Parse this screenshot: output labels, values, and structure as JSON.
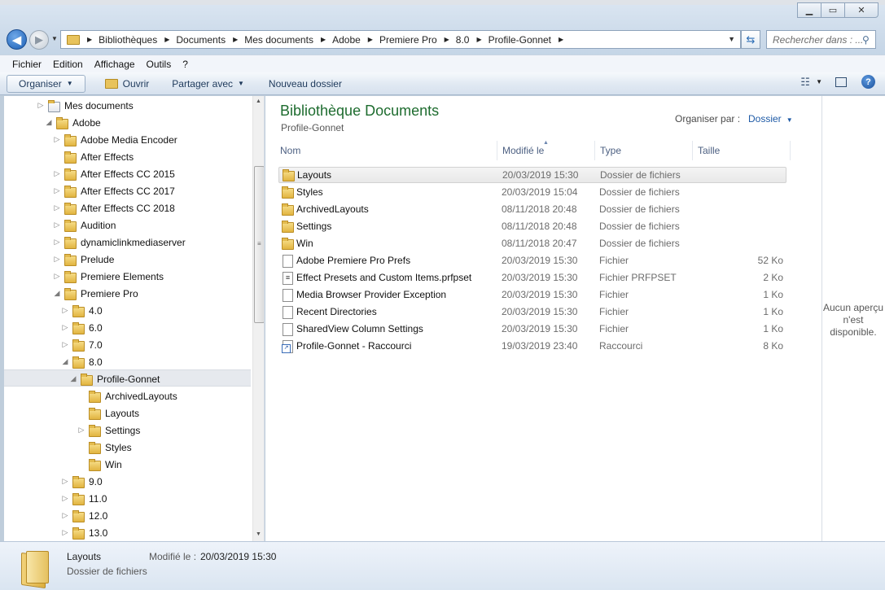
{
  "window": {
    "buttons": {
      "minimize": "▁",
      "maximize": "▭",
      "close": "✕"
    }
  },
  "address": {
    "crumbs": [
      "Bibliothèques",
      "Documents",
      "Mes documents",
      "Adobe",
      "Premiere Pro",
      "8.0",
      "Profile-Gonnet"
    ],
    "search_placeholder": "Rechercher dans : ..."
  },
  "menu": [
    "Fichier",
    "Edition",
    "Affichage",
    "Outils",
    "?"
  ],
  "toolbar": {
    "organiser": "Organiser",
    "ouvrir": "Ouvrir",
    "partager": "Partager avec",
    "nouveau": "Nouveau dossier"
  },
  "tree": [
    {
      "label": "Mes documents",
      "indent": 0,
      "expander": "▷",
      "icon": "doc"
    },
    {
      "label": "Adobe",
      "indent": 1,
      "expander": "◢",
      "icon": "folder"
    },
    {
      "label": "Adobe Media Encoder",
      "indent": 2,
      "expander": "▷",
      "icon": "folder"
    },
    {
      "label": "After Effects",
      "indent": 2,
      "expander": "",
      "icon": "folder"
    },
    {
      "label": "After Effects CC 2015",
      "indent": 2,
      "expander": "▷",
      "icon": "folder"
    },
    {
      "label": "After Effects CC 2017",
      "indent": 2,
      "expander": "▷",
      "icon": "folder"
    },
    {
      "label": "After Effects CC 2018",
      "indent": 2,
      "expander": "▷",
      "icon": "folder"
    },
    {
      "label": "Audition",
      "indent": 2,
      "expander": "▷",
      "icon": "folder"
    },
    {
      "label": "dynamiclinkmediaserver",
      "indent": 2,
      "expander": "▷",
      "icon": "folder"
    },
    {
      "label": "Prelude",
      "indent": 2,
      "expander": "▷",
      "icon": "folder"
    },
    {
      "label": "Premiere Elements",
      "indent": 2,
      "expander": "▷",
      "icon": "folder"
    },
    {
      "label": "Premiere Pro",
      "indent": 2,
      "expander": "◢",
      "icon": "folder"
    },
    {
      "label": "4.0",
      "indent": 3,
      "expander": "▷",
      "icon": "folder"
    },
    {
      "label": "6.0",
      "indent": 3,
      "expander": "▷",
      "icon": "folder"
    },
    {
      "label": "7.0",
      "indent": 3,
      "expander": "▷",
      "icon": "folder"
    },
    {
      "label": "8.0",
      "indent": 3,
      "expander": "◢",
      "icon": "folder"
    },
    {
      "label": "Profile-Gonnet",
      "indent": 4,
      "expander": "◢",
      "icon": "folder"
    },
    {
      "label": "ArchivedLayouts",
      "indent": 5,
      "expander": "",
      "icon": "folder"
    },
    {
      "label": "Layouts",
      "indent": 5,
      "expander": "",
      "icon": "folder"
    },
    {
      "label": "Settings",
      "indent": 5,
      "expander": "▷",
      "icon": "folder"
    },
    {
      "label": "Styles",
      "indent": 5,
      "expander": "",
      "icon": "folder"
    },
    {
      "label": "Win",
      "indent": 5,
      "expander": "",
      "icon": "folder"
    },
    {
      "label": "9.0",
      "indent": 3,
      "expander": "▷",
      "icon": "folder"
    },
    {
      "label": "11.0",
      "indent": 3,
      "expander": "▷",
      "icon": "folder"
    },
    {
      "label": "12.0",
      "indent": 3,
      "expander": "▷",
      "icon": "folder"
    },
    {
      "label": "13.0",
      "indent": 3,
      "expander": "▷",
      "icon": "folder"
    }
  ],
  "content": {
    "title": "Bibliothèque Documents",
    "subtitle": "Profile-Gonnet",
    "arrange_label": "Organiser par :",
    "arrange_value": "Dossier",
    "columns": {
      "name": "Nom",
      "modified": "Modifié le",
      "type": "Type",
      "size": "Taille"
    },
    "files": [
      {
        "name": "Layouts",
        "date": "20/03/2019 15:30",
        "type": "Dossier de fichiers",
        "size": "",
        "icon": "folder"
      },
      {
        "name": "Styles",
        "date": "20/03/2019 15:04",
        "type": "Dossier de fichiers",
        "size": "",
        "icon": "folder"
      },
      {
        "name": "ArchivedLayouts",
        "date": "08/11/2018 20:48",
        "type": "Dossier de fichiers",
        "size": "",
        "icon": "folder"
      },
      {
        "name": "Settings",
        "date": "08/11/2018 20:48",
        "type": "Dossier de fichiers",
        "size": "",
        "icon": "folder"
      },
      {
        "name": "Win",
        "date": "08/11/2018 20:47",
        "type": "Dossier de fichiers",
        "size": "",
        "icon": "folder"
      },
      {
        "name": "Adobe Premiere Pro Prefs",
        "date": "20/03/2019 15:30",
        "type": "Fichier",
        "size": "52 Ko",
        "icon": "file"
      },
      {
        "name": "Effect Presets and Custom Items.prfpset",
        "date": "20/03/2019 15:30",
        "type": "Fichier PRFPSET",
        "size": "2 Ko",
        "icon": "preset"
      },
      {
        "name": "Media Browser Provider Exception",
        "date": "20/03/2019 15:30",
        "type": "Fichier",
        "size": "1 Ko",
        "icon": "file"
      },
      {
        "name": "Recent Directories",
        "date": "20/03/2019 15:30",
        "type": "Fichier",
        "size": "1 Ko",
        "icon": "file"
      },
      {
        "name": "SharedView Column Settings",
        "date": "20/03/2019 15:30",
        "type": "Fichier",
        "size": "1 Ko",
        "icon": "file"
      },
      {
        "name": "Profile-Gonnet - Raccourci",
        "date": "19/03/2019 23:40",
        "type": "Raccourci",
        "size": "8 Ko",
        "icon": "link"
      }
    ]
  },
  "preview_text": "Aucun aperçu n'est disponible.",
  "details": {
    "name": "Layouts",
    "type": "Dossier de fichiers",
    "modified_label": "Modifié le :",
    "modified_value": "20/03/2019 15:30"
  }
}
